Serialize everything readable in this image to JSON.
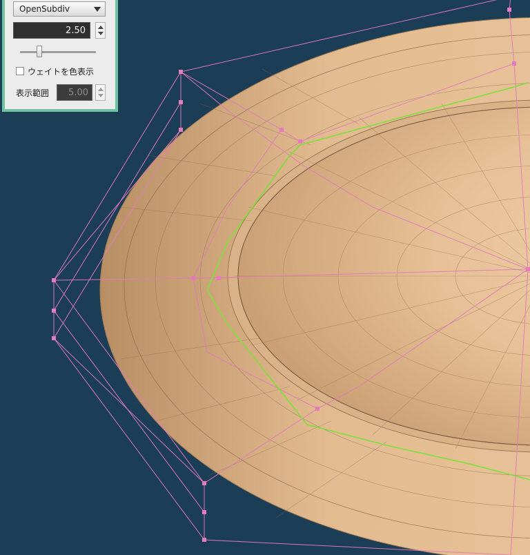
{
  "panel": {
    "mode_select": {
      "value": "OpenSubdiv",
      "icon": "chevron-down-icon"
    },
    "level": {
      "value": "2.50"
    },
    "level_slider": {
      "fraction": 0.25
    },
    "weight_checkbox": {
      "label": "ウェイトを色表示",
      "checked": false
    },
    "display_range": {
      "label": "表示範囲",
      "value": "5.00",
      "enabled": false
    },
    "accent_color": "#6fc3a1"
  },
  "viewport": {
    "background_color": "#1b3d56",
    "mesh_color": "#e8c39c",
    "cage_color": "#e47bbd",
    "edge_loop_color": "#7ee03a"
  }
}
